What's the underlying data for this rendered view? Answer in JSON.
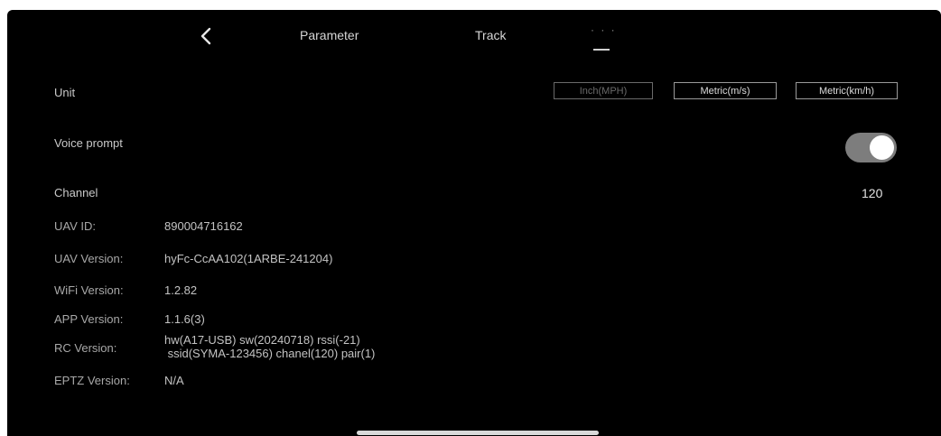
{
  "nav": {
    "back_icon": "chevron-left-icon",
    "tabs": [
      {
        "label": "Parameter"
      },
      {
        "label": "Track"
      },
      {
        "label": "· · ·",
        "selected": true
      }
    ]
  },
  "settings": {
    "unit": {
      "label": "Unit",
      "options": [
        "Inch(MPH)",
        "Metric(m/s)",
        "Metric(km/h)"
      ]
    },
    "voice_prompt": {
      "label": "Voice prompt",
      "enabled": true
    },
    "channel": {
      "label": "Channel",
      "value": "120"
    }
  },
  "info": [
    {
      "label": "UAV ID:",
      "value": "890004716162"
    },
    {
      "label": "UAV Version:",
      "value": "hyFc-CcAA102(1ARBE-241204)"
    },
    {
      "label": "WiFi Version:",
      "value": "1.2.82"
    },
    {
      "label": "APP Version:",
      "value": "1.1.6(3)"
    },
    {
      "label": "RC Version:",
      "value_line1": "hw(A17-USB) sw(20240718) rssi(-21)",
      "value_line2": " ssid(SYMA-123456) chanel(120) pair(1)"
    },
    {
      "label": "EPTZ Version:",
      "value": "N/A"
    }
  ],
  "colors": {
    "background": "#000000",
    "toggle_track": "#7d7d7d",
    "toggle_knob": "#ffffff"
  }
}
